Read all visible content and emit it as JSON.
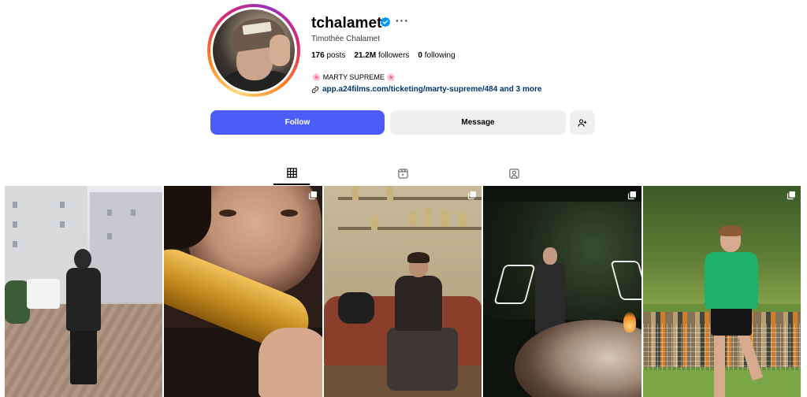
{
  "profile": {
    "username": "tchalamet",
    "full_name": "Timothée Chalamet",
    "verified": true,
    "more_label": "···",
    "stats": {
      "posts_count": "176",
      "posts_label": "posts",
      "followers_count": "21.2M",
      "followers_label": "followers",
      "following_count": "0",
      "following_label": "following"
    },
    "bio": "MARTY SUPREME",
    "bio_emoji_left": "🌸",
    "bio_emoji_right": "🌸",
    "link": "app.a24films.com/ticketing/marty-supreme/484 and 3 more"
  },
  "actions": {
    "follow_label": "Follow",
    "message_label": "Message",
    "suggest_icon": "add-person-icon"
  },
  "tabs": [
    {
      "name": "posts",
      "icon": "grid-icon",
      "active": true
    },
    {
      "name": "reels",
      "icon": "reels-icon",
      "active": false
    },
    {
      "name": "tagged",
      "icon": "tagged-icon",
      "active": false
    }
  ],
  "grid": [
    {
      "subject": "street-photo",
      "multi": false
    },
    {
      "subject": "closeup-gold-tube",
      "multi": true
    },
    {
      "subject": "trophy-room",
      "multi": true
    },
    {
      "subject": "night-garden-firepit",
      "multi": true
    },
    {
      "subject": "soccer-player",
      "multi": true
    }
  ],
  "colors": {
    "follow_button": "#4a5df9",
    "verified_badge": "#0095f6",
    "link_text": "#00376b",
    "secondary_button": "#efefef"
  }
}
